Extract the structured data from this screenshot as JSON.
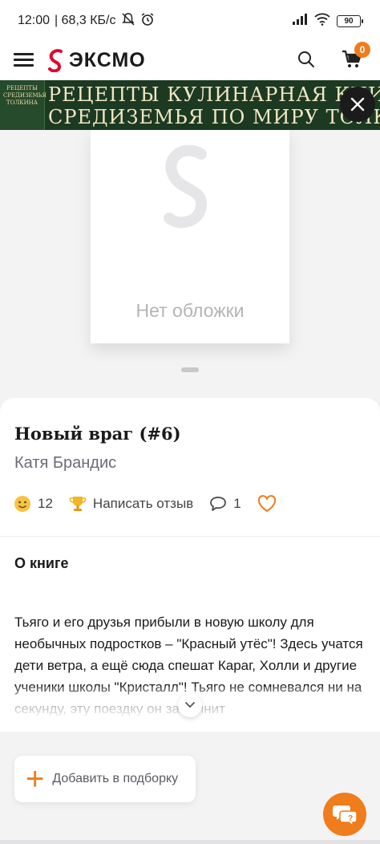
{
  "status_bar": {
    "time": "12:00",
    "network_speed": "| 68,3 КБ/с",
    "battery": "90"
  },
  "header": {
    "logo_text": "ЭКСМО",
    "cart_count": "0"
  },
  "banner": {
    "line1": "РЕЦЕПТЫ  КУЛИНАРНАЯ КНИГА",
    "line2": "СРЕДИЗЕМЬЯ  ПО МИРУ  ТОЛКИНА",
    "book_text": "РЕЦЕПТЫ СРЕДИЗЕМЬЯ ТОЛКИНА"
  },
  "cover": {
    "placeholder_text": "Нет обложки"
  },
  "book": {
    "title": "Новый враг (#6)",
    "author": "Катя Брандис",
    "rating_count": "12",
    "review_link": "Написать отзыв",
    "comments_count": "1"
  },
  "about": {
    "heading": "О книге",
    "text": "Тьяго и его друзья прибыли в новую школу для необычных подростков – \"Красный утёс\"! Здесь учатся дети ветра, а ещё сюда спешат Караг, Холли и другие ученики школы \"Кристалл\"! Тьяго не сомневался ни на секунду, эту поездку он запомнит"
  },
  "actions": {
    "add_to_collection": "Добавить в подборку"
  },
  "colors": {
    "accent": "#f07c1b",
    "logo_red": "#e4002b",
    "banner_bg": "#1c3a22"
  }
}
